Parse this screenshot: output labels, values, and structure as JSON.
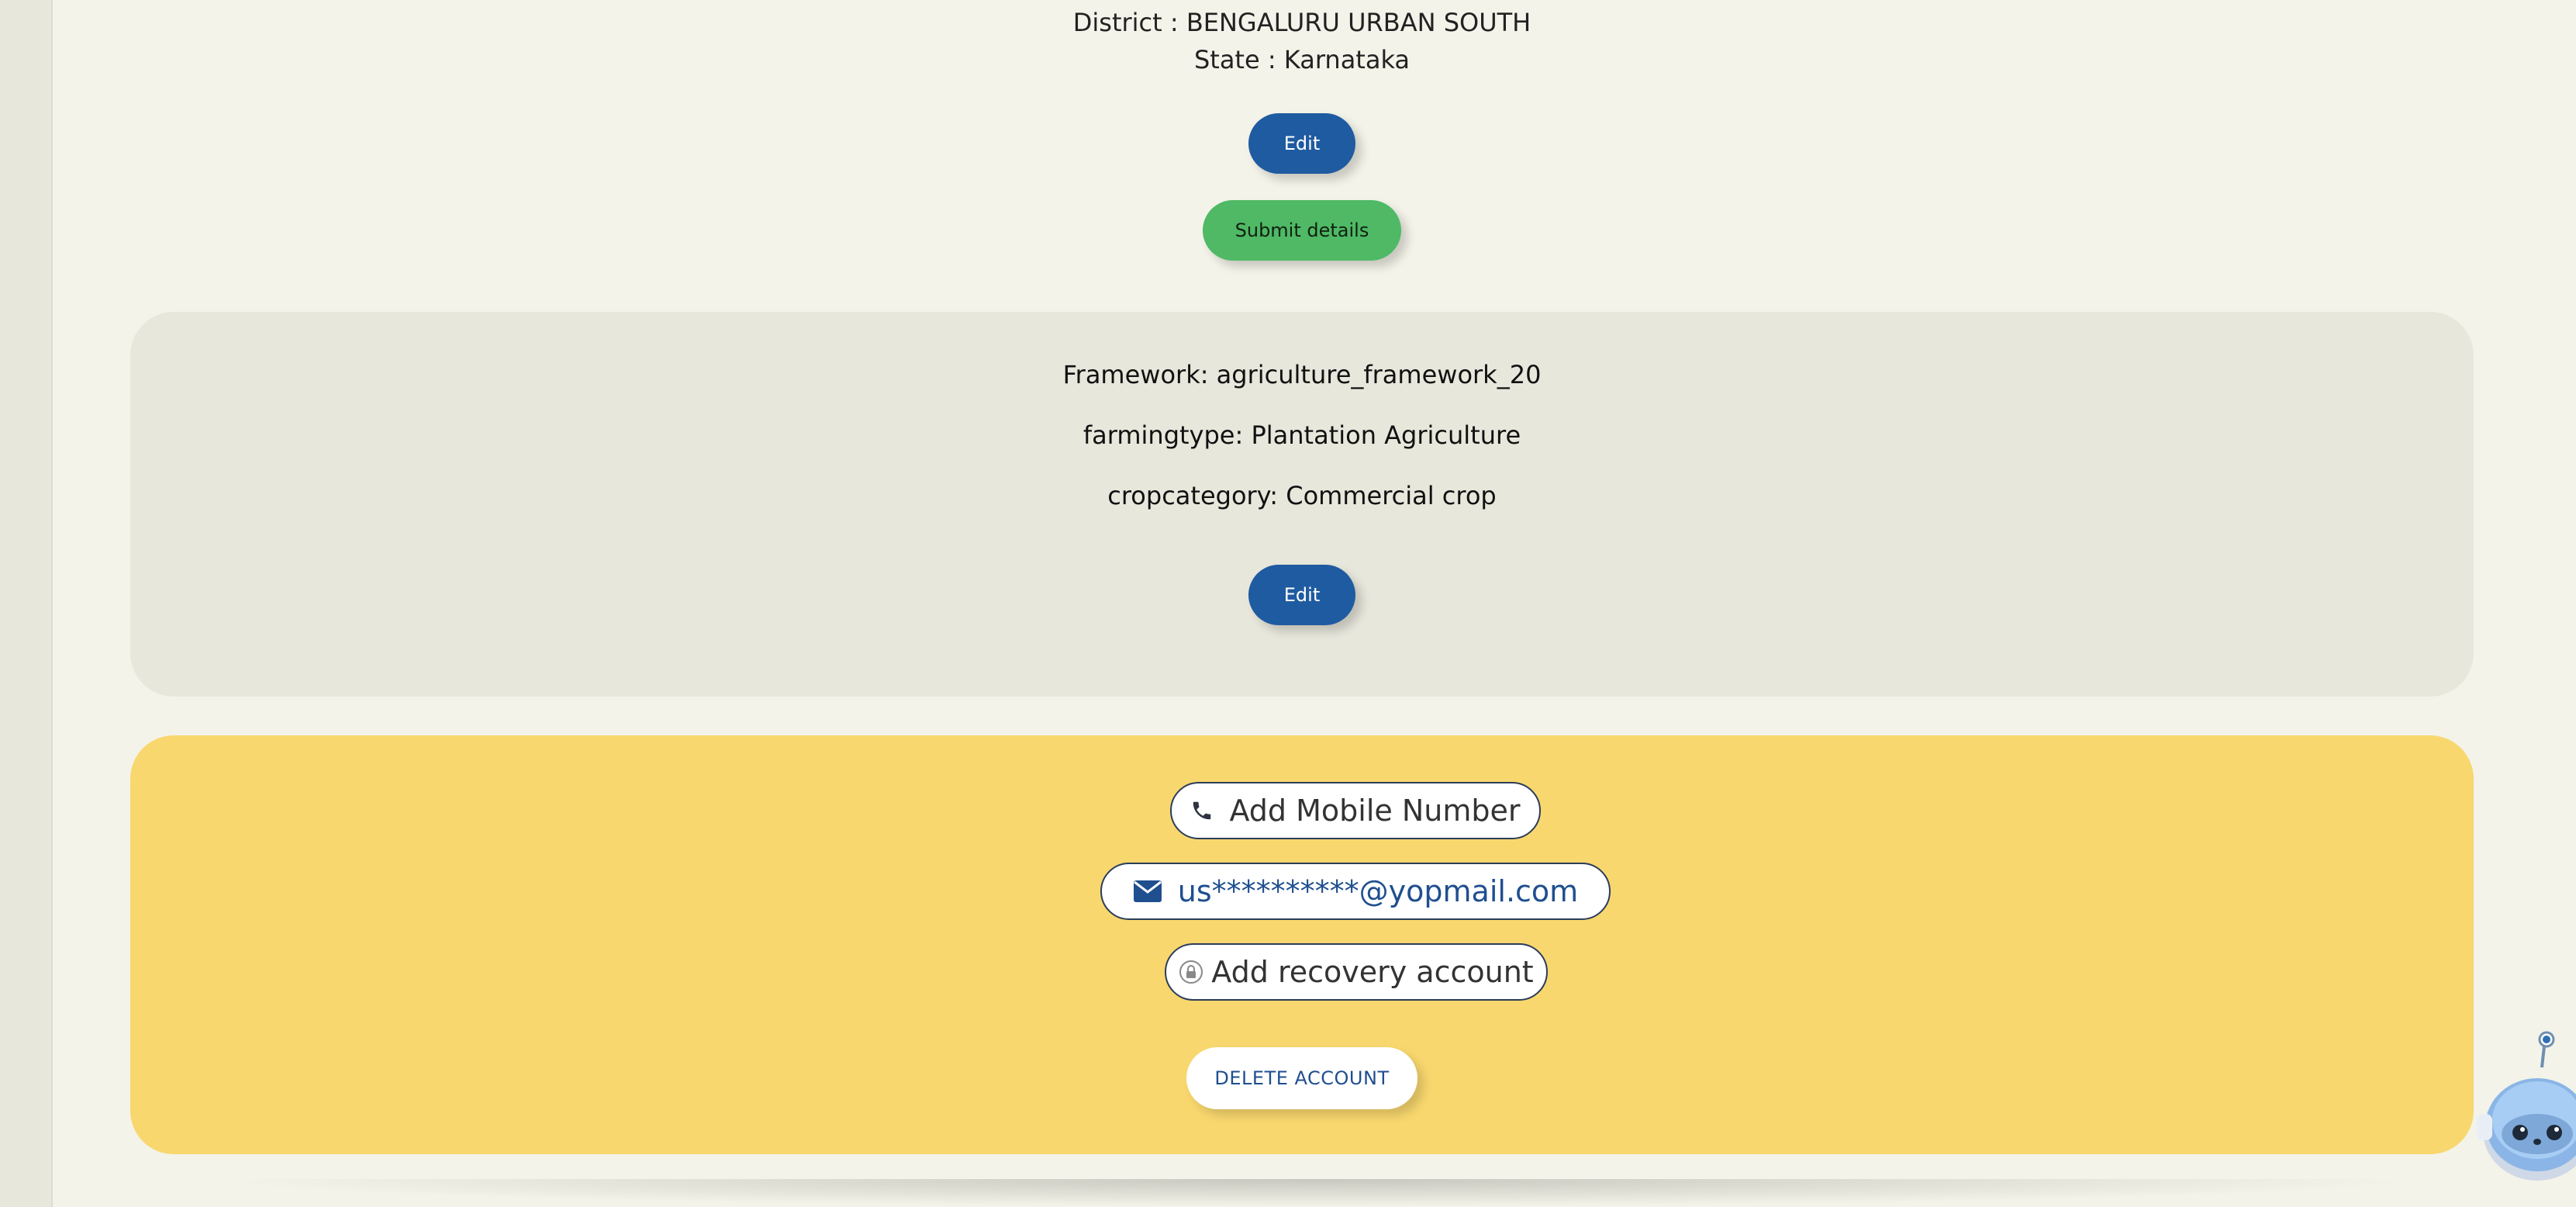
{
  "address": {
    "district_line": "District : BENGALURU URBAN SOUTH",
    "state_line": "State : Karnataka",
    "edit_label": "Edit",
    "submit_label": "Submit details"
  },
  "framework_panel": {
    "framework_line": "Framework: agriculture_framework_20",
    "farmingtype_line": "farmingtype: Plantation Agriculture",
    "cropcategory_line": "cropcategory: Commercial crop",
    "edit_label": "Edit"
  },
  "account_panel": {
    "mobile_label": "Add Mobile Number",
    "email_value": "us**********@yopmail.com",
    "recovery_label": "Add recovery account",
    "delete_label": "DELETE ACCOUNT"
  },
  "icons": {
    "mobile": "phone-icon",
    "email": "envelope-icon",
    "recovery": "lock-icon",
    "assistant": "robot-assistant-icon"
  },
  "colors": {
    "edit_button": "#1f5ba0",
    "submit_button": "#4fb965",
    "account_panel": "#f8d76e",
    "framework_panel": "#e8e7dc",
    "email_text": "#1f4f8f"
  }
}
